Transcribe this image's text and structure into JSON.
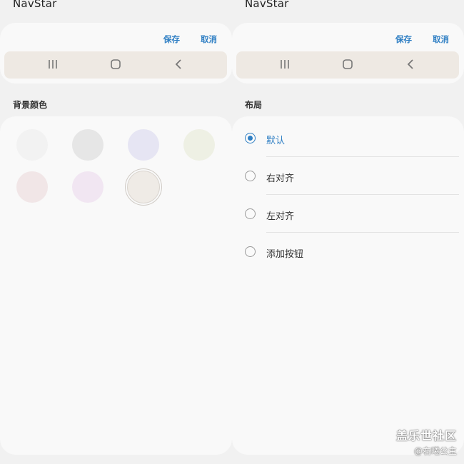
{
  "left_panel": {
    "title": "NavStar",
    "save_label": "保存",
    "cancel_label": "取消",
    "nav_icons": [
      "recent-apps-icon",
      "home-icon",
      "back-icon"
    ],
    "section_label": "背景颜色",
    "swatches": [
      {
        "color": "#f2f2f2",
        "selected": false
      },
      {
        "color": "#e6e6e6",
        "selected": false
      },
      {
        "color": "#e6e5f3",
        "selected": false
      },
      {
        "color": "#eef0e4",
        "selected": false
      },
      {
        "color": "#f1e6e7",
        "selected": false
      },
      {
        "color": "#f1e6f2",
        "selected": false
      },
      {
        "color": "#efebe6",
        "selected": true
      }
    ],
    "nav_bar_color": "#eee9e3"
  },
  "right_panel": {
    "title": "NavStar",
    "save_label": "保存",
    "cancel_label": "取消",
    "section_label": "布局",
    "options": [
      {
        "label": "默认",
        "selected": true
      },
      {
        "label": "右对齐",
        "selected": false
      },
      {
        "label": "左对齐",
        "selected": false
      },
      {
        "label": "添加按钮",
        "selected": false
      }
    ]
  },
  "watermark": {
    "main": "盖乐世社区",
    "sub": "@右曦公主"
  },
  "colors": {
    "accent": "#2f7fc4",
    "card": "#f9f9f9",
    "background": "#f1f1f1"
  }
}
